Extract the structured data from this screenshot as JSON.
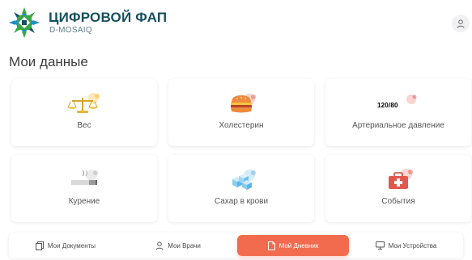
{
  "header": {
    "brand_title": "ЦИФРОВОЙ ФАП",
    "brand_subtitle": "D-MOSAIQ",
    "logo_icon": "mosaic-star-logo",
    "profile_icon": "user-icon"
  },
  "page_title": "Мои данные",
  "cards": [
    {
      "label": "Вес",
      "icon": "scales-icon"
    },
    {
      "label": "Холестерин",
      "icon": "burger-icon"
    },
    {
      "label": "Артериальное давление",
      "icon": "blood-pressure-icon",
      "icon_text": "120/80"
    },
    {
      "label": "Курение",
      "icon": "cigarette-icon"
    },
    {
      "label": "Сахар в крови",
      "icon": "sugar-cubes-icon"
    },
    {
      "label": "События",
      "icon": "first-aid-kit-icon"
    }
  ],
  "bottom_nav": [
    {
      "label": "Мои Документы",
      "icon": "documents-icon",
      "active": false
    },
    {
      "label": "Мои Врачи",
      "icon": "doctor-icon",
      "active": false
    },
    {
      "label": "Мой Дневник",
      "icon": "diary-icon",
      "active": true
    },
    {
      "label": "Мои Устройства",
      "icon": "monitor-icon",
      "active": false
    }
  ],
  "colors": {
    "brand": "#16505e",
    "accent": "#f26b4f",
    "logo_green": "#3aa64a",
    "logo_blue": "#1f8fc4",
    "icon_yellow": "#f6c23e",
    "icon_orange": "#f08a3c",
    "icon_red": "#e2574c",
    "icon_blue": "#5bb6e8"
  }
}
